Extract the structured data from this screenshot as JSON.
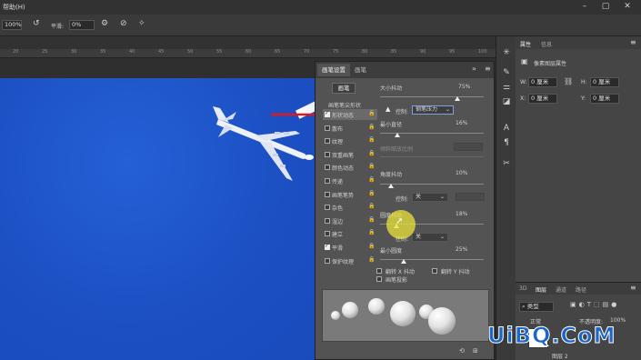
{
  "menubar": {
    "title": "帮助(H)"
  },
  "options": {
    "size": "100%",
    "smooth_label": "平滑:",
    "smooth_value": "0%"
  },
  "ruler_ticks": [
    "20",
    "25",
    "30",
    "35",
    "40",
    "45",
    "50",
    "55",
    "60",
    "65",
    "70",
    "75",
    "80",
    "85",
    "90",
    "95",
    "100"
  ],
  "brush_panel": {
    "tab_settings": "画笔设置",
    "tab_brushes": "画笔",
    "brushes_button": "画笔",
    "tip_shape": "画笔笔尖形状",
    "items": [
      {
        "label": "形状动态",
        "checked": true
      },
      {
        "label": "散布",
        "checked": false
      },
      {
        "label": "纹理",
        "checked": false
      },
      {
        "label": "双重画笔",
        "checked": false
      },
      {
        "label": "颜色动态",
        "checked": false
      },
      {
        "label": "传递",
        "checked": false
      },
      {
        "label": "画笔笔势",
        "checked": false
      },
      {
        "label": "杂色",
        "checked": false
      },
      {
        "label": "湿边",
        "checked": false
      },
      {
        "label": "建立",
        "checked": false
      },
      {
        "label": "平滑",
        "checked": true
      },
      {
        "label": "保护纹理",
        "checked": false
      }
    ],
    "size_jitter_label": "大小抖动",
    "size_jitter_value": "75%",
    "control_label": "控制:",
    "control_value": "钢笔压力",
    "min_diameter_label": "最小直径",
    "min_diameter_value": "16%",
    "tilt_scale_label": "倾斜缩放比例",
    "angle_jitter_label": "角度抖动",
    "angle_jitter_value": "10%",
    "angle_control_value": "关",
    "roundness_jitter_label": "圆度抖动",
    "roundness_jitter_value": "18%",
    "roundness_control_value": "关",
    "min_roundness_label": "最小圆度",
    "min_roundness_value": "25%",
    "flip_x_label": "翻转 X 抖动",
    "flip_y_label": "翻转 Y 抖动",
    "brush_projection_label": "画笔投影"
  },
  "properties": {
    "tab_properties": "属性",
    "tab_info": "信息",
    "title": "像素图层属性",
    "w_label": "W:",
    "w_value": "0 厘米",
    "h_label": "H:",
    "h_value": "0 厘米",
    "x_label": "X:",
    "x_value": "0 厘米",
    "y_label": "Y:",
    "y_value": "0 厘米"
  },
  "layers": {
    "tab_3d": "3D",
    "tab_layers": "图层",
    "tab_channels": "通道",
    "tab_paths": "路径",
    "filter_label": "类型",
    "blend_mode": "正常",
    "opacity_label": "不透明度:",
    "opacity_value": "100%",
    "layer_name": "图层 2"
  },
  "watermark": "UiBQ.CoM",
  "colors": {
    "sky": "#1c52c6",
    "arrow": "#e0181c",
    "cursor_highlight": "#e9e33a"
  }
}
